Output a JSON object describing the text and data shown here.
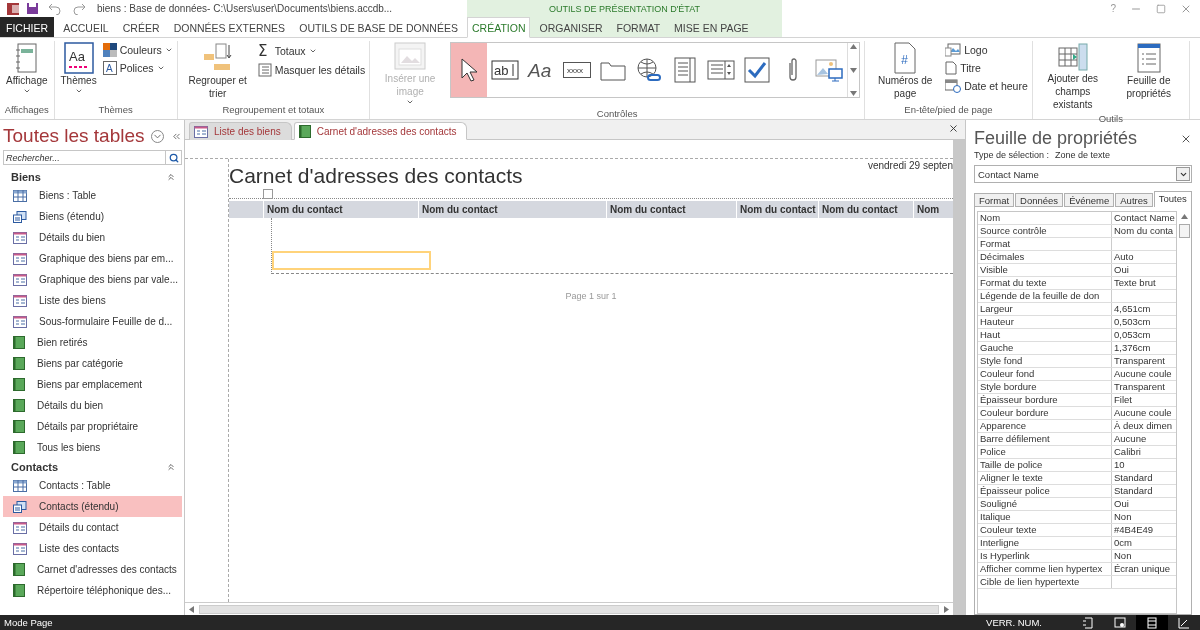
{
  "title_bar": {
    "title": "biens : Base de données- C:\\Users\\user\\Documents\\biens.accdb...",
    "context_label": "OUTILS DE PRÉSENTATION D'ÉTAT",
    "help": "?"
  },
  "ribbon_tabs": [
    {
      "label": "FICHIER",
      "kind": "file",
      "selected": false
    },
    {
      "label": "ACCUEIL",
      "kind": "tab",
      "selected": false
    },
    {
      "label": "CRÉER",
      "kind": "tab",
      "selected": false
    },
    {
      "label": "DONNÉES EXTERNES",
      "kind": "tab",
      "selected": false
    },
    {
      "label": "OUTILS DE BASE DE DONNÉES",
      "kind": "tab",
      "selected": false
    },
    {
      "label": "CRÉATION",
      "kind": "context",
      "selected": true
    },
    {
      "label": "ORGANISER",
      "kind": "context",
      "selected": false
    },
    {
      "label": "FORMAT",
      "kind": "context",
      "selected": false
    },
    {
      "label": "MISE EN PAGE",
      "kind": "context",
      "selected": false
    }
  ],
  "ribbon_groups": [
    {
      "label": "Affichages",
      "controls": [
        {
          "label": "Affichage",
          "kind": "large",
          "dropdown": true
        }
      ]
    },
    {
      "label": "Thèmes",
      "controls": [
        {
          "label": "Thèmes",
          "kind": "large",
          "dropdown": true,
          "icon_text": "Aa"
        },
        {
          "label": "Couleurs",
          "kind": "small",
          "dropdown": true
        },
        {
          "label": "Polices",
          "kind": "small",
          "dropdown": true,
          "icon_text": "A"
        }
      ]
    },
    {
      "label": "Regroupement et totaux",
      "controls": [
        {
          "label": "Regrouper et trier",
          "kind": "large",
          "dropdown": false
        },
        {
          "label": "Totaux",
          "kind": "small",
          "dropdown": true,
          "icon_text": "Σ"
        },
        {
          "label": "Masquer les détails",
          "kind": "small",
          "dropdown": false
        }
      ]
    },
    {
      "label": "Contrôles",
      "gallery": [
        {
          "selected": true
        },
        {
          "selected": false,
          "icon_text": "ab"
        },
        {
          "selected": false,
          "icon_text": "Aa"
        },
        {
          "selected": false,
          "icon_text": "xxxx"
        },
        {
          "selected": false
        },
        {
          "selected": false
        },
        {
          "selected": false
        },
        {
          "selected": false
        },
        {
          "selected": false
        },
        {
          "selected": false
        },
        {
          "selected": false
        }
      ],
      "controls": [
        {
          "label": "Insérer une image",
          "kind": "large",
          "dropdown": true,
          "disabled": true
        }
      ]
    },
    {
      "label": "En-tête/pied de page",
      "controls": [
        {
          "label": "Numéros de page",
          "kind": "large",
          "dropdown": false,
          "icon_text": "#"
        },
        {
          "label": "Logo",
          "kind": "small",
          "dropdown": false
        },
        {
          "label": "Titre",
          "kind": "small",
          "dropdown": false
        },
        {
          "label": "Date et heure",
          "kind": "small",
          "dropdown": false
        }
      ]
    },
    {
      "label": "Outils",
      "controls": [
        {
          "label": "Ajouter des champs existants",
          "kind": "large",
          "dropdown": false
        },
        {
          "label": "Feuille de propriétés",
          "kind": "large",
          "dropdown": false
        }
      ]
    }
  ],
  "navigation": {
    "title": "Toutes les tables",
    "search_placeholder": "Rechercher...",
    "groups": [
      {
        "label": "Biens",
        "expanded": true,
        "items": [
          {
            "label": "Biens : Table",
            "kind": "table",
            "selected": false
          },
          {
            "label": "Biens (étendu)",
            "kind": "query",
            "selected": false
          },
          {
            "label": "Détails du bien",
            "kind": "form",
            "selected": false
          },
          {
            "label": "Graphique des biens par em...",
            "kind": "form",
            "selected": false
          },
          {
            "label": "Graphique des biens par vale...",
            "kind": "form",
            "selected": false
          },
          {
            "label": "Liste des biens",
            "kind": "form",
            "selected": false
          },
          {
            "label": "Sous-formulaire Feuille de d...",
            "kind": "form",
            "selected": false
          },
          {
            "label": "Bien retirés",
            "kind": "report",
            "selected": false
          },
          {
            "label": "Biens par catégorie",
            "kind": "report",
            "selected": false
          },
          {
            "label": "Biens par emplacement",
            "kind": "report",
            "selected": false
          },
          {
            "label": "Détails du bien",
            "kind": "report",
            "selected": false
          },
          {
            "label": "Détails par propriétaire",
            "kind": "report",
            "selected": false
          },
          {
            "label": "Tous les biens",
            "kind": "report",
            "selected": false
          }
        ]
      },
      {
        "label": "Contacts",
        "expanded": true,
        "items": [
          {
            "label": "Contacts : Table",
            "kind": "table",
            "selected": false
          },
          {
            "label": "Contacts (étendu)",
            "kind": "query",
            "selected": true
          },
          {
            "label": "Détails du contact",
            "kind": "form",
            "selected": false
          },
          {
            "label": "Liste des contacts",
            "kind": "form",
            "selected": false
          },
          {
            "label": "Carnet d'adresses des contacts",
            "kind": "report",
            "selected": false
          },
          {
            "label": "Répertoire téléphonique des...",
            "kind": "report",
            "selected": false
          }
        ]
      }
    ]
  },
  "document_tabs": [
    {
      "label": "Liste des biens",
      "kind": "form",
      "selected": false
    },
    {
      "label": "Carnet d'adresses des contacts",
      "kind": "report",
      "selected": true
    }
  ],
  "report": {
    "title": "Carnet d'adresses des contacts",
    "date": "vendredi 29 septen",
    "columns": [
      "Nom du contact",
      "Nom du contact",
      "Nom du contact",
      "Nom du contact",
      "Nom du contact",
      "Nom"
    ],
    "footer": "Page 1 sur 1"
  },
  "property_sheet": {
    "title": "Feuille de propriétés",
    "selection_label": "Type de sélection :",
    "selection_type": "Zone de texte",
    "object": "Contact Name",
    "tabs": [
      {
        "label": "Format",
        "selected": false
      },
      {
        "label": "Données",
        "selected": false
      },
      {
        "label": "Événeme",
        "selected": false
      },
      {
        "label": "Autres",
        "selected": false
      },
      {
        "label": "Toutes",
        "selected": true
      }
    ],
    "rows": [
      {
        "name": "Nom",
        "value": "Contact Name"
      },
      {
        "name": "Source contrôle",
        "value": "Nom du conta"
      },
      {
        "name": "Format"
      },
      {
        "name": "Décimales",
        "value": "Auto"
      },
      {
        "name": "Visible",
        "value": "Oui"
      },
      {
        "name": "Format du texte",
        "value": "Texte brut"
      },
      {
        "name": "Légende de la feuille de don"
      },
      {
        "name": "Largeur",
        "value": "4,651cm"
      },
      {
        "name": "Hauteur",
        "value": "0,503cm"
      },
      {
        "name": "Haut",
        "value": "0,053cm"
      },
      {
        "name": "Gauche",
        "value": "1,376cm"
      },
      {
        "name": "Style fond",
        "value": "Transparent"
      },
      {
        "name": "Couleur fond",
        "value": "Aucune coule"
      },
      {
        "name": "Style bordure",
        "value": "Transparent"
      },
      {
        "name": "Épaisseur bordure",
        "value": "Filet"
      },
      {
        "name": "Couleur bordure",
        "value": "Aucune coule"
      },
      {
        "name": "Apparence",
        "value": "À deux dimen"
      },
      {
        "name": "Barre défilement",
        "value": "Aucune"
      },
      {
        "name": "Police",
        "value": "Calibri"
      },
      {
        "name": "Taille de police",
        "value": "10"
      },
      {
        "name": "Aligner le texte",
        "value": "Standard"
      },
      {
        "name": "Épaisseur police",
        "value": "Standard"
      },
      {
        "name": "Souligné",
        "value": "Oui"
      },
      {
        "name": "Italique",
        "value": "Non"
      },
      {
        "name": "Couleur texte",
        "value": "#4B4E49"
      },
      {
        "name": "Interligne",
        "value": "0cm"
      },
      {
        "name": "Is Hyperlink",
        "value": "Non"
      },
      {
        "name": "Afficher comme lien hypertex",
        "value": "Écran unique"
      },
      {
        "name": "Cible de lien hypertexte"
      }
    ]
  },
  "status_bar": {
    "mode": "Mode Page",
    "indicator": "VERR. NUM.",
    "views": [
      {
        "selected": false
      },
      {
        "selected": false
      },
      {
        "selected": true
      },
      {
        "selected": false
      }
    ]
  }
}
